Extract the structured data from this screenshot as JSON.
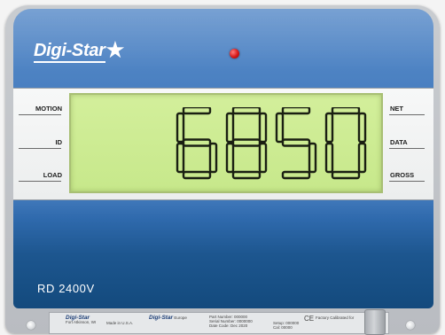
{
  "brand": {
    "name": "Digi-Star",
    "star": "★"
  },
  "display": {
    "reading": "6850",
    "annunciators_left": [
      "MOTION",
      "ID",
      "LOAD"
    ],
    "annunciators_right": [
      "NET",
      "DATA",
      "GROSS"
    ]
  },
  "model": "RD 2400V",
  "label_plate": {
    "logo_1": "Digi-Star",
    "text_1a": "Fort Atkinson, WI",
    "text_1b": "Made in U.S.A.",
    "logo_2": "Digi-Star",
    "text_2": "Europe",
    "part_number": "Part Number: 000000",
    "serial_number": "Serial Number: 0000000",
    "date_code": "Date Code: Dec 2020",
    "setup": "Setup: 000000",
    "cal": "Cal: 00000",
    "ce_mark": "CE",
    "factory_note": "Factory Calibrated for"
  },
  "colors": {
    "face_blue": "#4a80c1",
    "lcd_green": "#c7e88b",
    "segment": "#1a1f12",
    "led": "#d51818"
  }
}
